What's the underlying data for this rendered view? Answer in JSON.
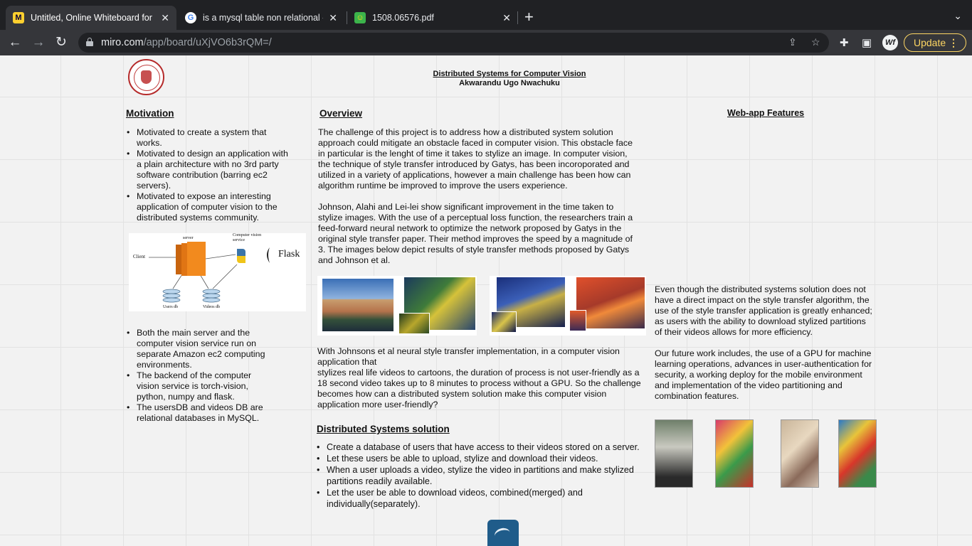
{
  "browser": {
    "tabs": [
      {
        "title": "Untitled, Online Whiteboard for",
        "favicon": "miro-icon",
        "active": true
      },
      {
        "title": "is a mysql table non relational -",
        "favicon": "google-icon",
        "active": false
      },
      {
        "title": "1508.06576.pdf",
        "favicon": "pdf-smiley-icon",
        "active": false
      }
    ],
    "url_host": "miro.com",
    "url_path": "/app/board/uXjVO6b3rQM=/",
    "update_label": "Update",
    "profile_initials": "Wf"
  },
  "poster": {
    "title": "Distributed Systems for Computer Vision",
    "author": "Akwarandu Ugo Nwachuku",
    "motivation": {
      "heading": "Motivation",
      "items": [
        "Motivated to create a system that works.",
        "Motivated to design an application with a plain architecture with no 3rd party software contribution (barring ec2 servers).",
        "Motivated to expose an interesting application of computer vision to the distributed systems community."
      ]
    },
    "diagram": {
      "client": "Client",
      "server": "server",
      "cv_service": "Computer vision service",
      "flask": "Flask",
      "users_db": "Users db",
      "videos_db": "Videos db"
    },
    "architecture": {
      "items": [
        " Both the main server and the computer vision service run on separate Amazon ec2 computing environments.",
        "The backend of the computer vision service is torch-vision, python, numpy and flask.",
        "The usersDB and videos DB are relational databases in MySQL."
      ]
    },
    "overview": {
      "heading": "Overview",
      "p1": "The challenge of this project is to address how a distributed system solution approach could mitigate an obstacle faced in computer vision. This obstacle face in particular is the lenght of time it takes to stylize an image. In computer vision, the technique of style transfer introduced by Gatys, has been incoroporated and utilized in a variety of applications, however a main challenge has been how can algorithm runtime be improved to improve the users experience.",
      "p2": "Johnson, Alahi and Lei-lei show significant improvement in the time taken to stylize images. With the use of a perceptual loss function, the researchers train a feed-forward neural network to optimize the network proposed by Gatys in the original style transfer paper. Their method improves the speed by a magnitude of 3. The images below depict results of style transfer methods proposed by Gatys and Johnson et al.",
      "p3": "With Johnsons et al neural style transfer implementation, in a computer vision application that",
      "p4": "stylizes real life videos to cartoons, the duration of process is not user-friendly as a 18 second video takes up to 8 minutes to process without a GPU. So the challenge becomes how can a distributed system solution make this computer vision application more user-friendly?"
    },
    "solution": {
      "heading": "Distributed Systems solution",
      "items": [
        "Create a database of users that have access to their videos stored on a server.",
        "Let these users be able to upload, stylize and download their videos.",
        "When a user uploads a video, stylize the video in partitions and make stylized partitions readily available.",
        "Let the user be able to download videos, combined(merged) and individually(separately)."
      ]
    },
    "features": {
      "heading": "Web-app Features",
      "p1": "Even though the distributed systems solution does not have a direct impact on the style transfer algorithm, the use of the style transfer application is greatly enhanced; as users with the ability to download stylized partitions of their videos allows for more efficiency.",
      "p2": "Our future work includes, the use of a GPU for machine learning operations, advances in user-authentication for security, a working deploy for the mobile environment and implementation of the video partitioning and combination features."
    }
  },
  "colors": {
    "chrome_dark": "#202124",
    "chrome_toolbar": "#35363a",
    "update_accent": "#fdd663",
    "board_bg": "#f2f2f2",
    "server_orange": "#f28a1e"
  }
}
